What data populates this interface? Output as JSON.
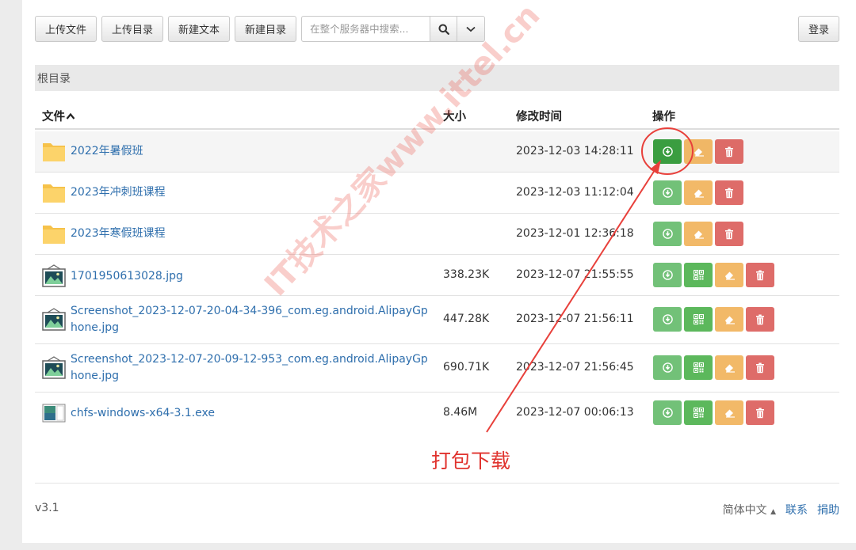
{
  "toolbar": {
    "upload_file": "上传文件",
    "upload_dir": "上传目录",
    "new_text": "新建文本",
    "new_dir": "新建目录",
    "search_placeholder": "在整个服务器中搜索...",
    "login": "登录"
  },
  "breadcrumb": "根目录",
  "columns": {
    "file": "文件",
    "size": "大小",
    "mtime": "修改时间",
    "ops": "操作"
  },
  "rows": [
    {
      "name": "2022年暑假班",
      "size": "",
      "mtime": "2023-12-03 14:28:11",
      "type": "folder"
    },
    {
      "name": "2023年冲刺班课程",
      "size": "",
      "mtime": "2023-12-03 11:12:04",
      "type": "folder"
    },
    {
      "name": "2023年寒假班课程",
      "size": "",
      "mtime": "2023-12-01 12:36:18",
      "type": "folder"
    },
    {
      "name": "1701950613028.jpg",
      "size": "338.23K",
      "mtime": "2023-12-07 21:55:55",
      "type": "image"
    },
    {
      "name": "Screenshot_2023-12-07-20-04-34-396_com.eg.android.AlipayGphone.jpg",
      "size": "447.28K",
      "mtime": "2023-12-07 21:56:11",
      "type": "image"
    },
    {
      "name": "Screenshot_2023-12-07-20-09-12-953_com.eg.android.AlipayGphone.jpg",
      "size": "690.71K",
      "mtime": "2023-12-07 21:56:45",
      "type": "image"
    },
    {
      "name": "chfs-windows-x64-3.1.exe",
      "size": "8.46M",
      "mtime": "2023-12-07 00:06:13",
      "type": "exe"
    }
  ],
  "footer": {
    "version": "v3.1",
    "language": "简体中文",
    "contact": "联系",
    "donate": "捐助"
  },
  "annotation": "打包下载",
  "watermark": "IT技术之家www.ittel.cn",
  "colors": {
    "link": "#2f6fad",
    "download": "#72c178",
    "download_active": "#3a9d40",
    "edit": "#f0ad4e",
    "delete": "#d9534f",
    "annotation": "#e0332e"
  }
}
